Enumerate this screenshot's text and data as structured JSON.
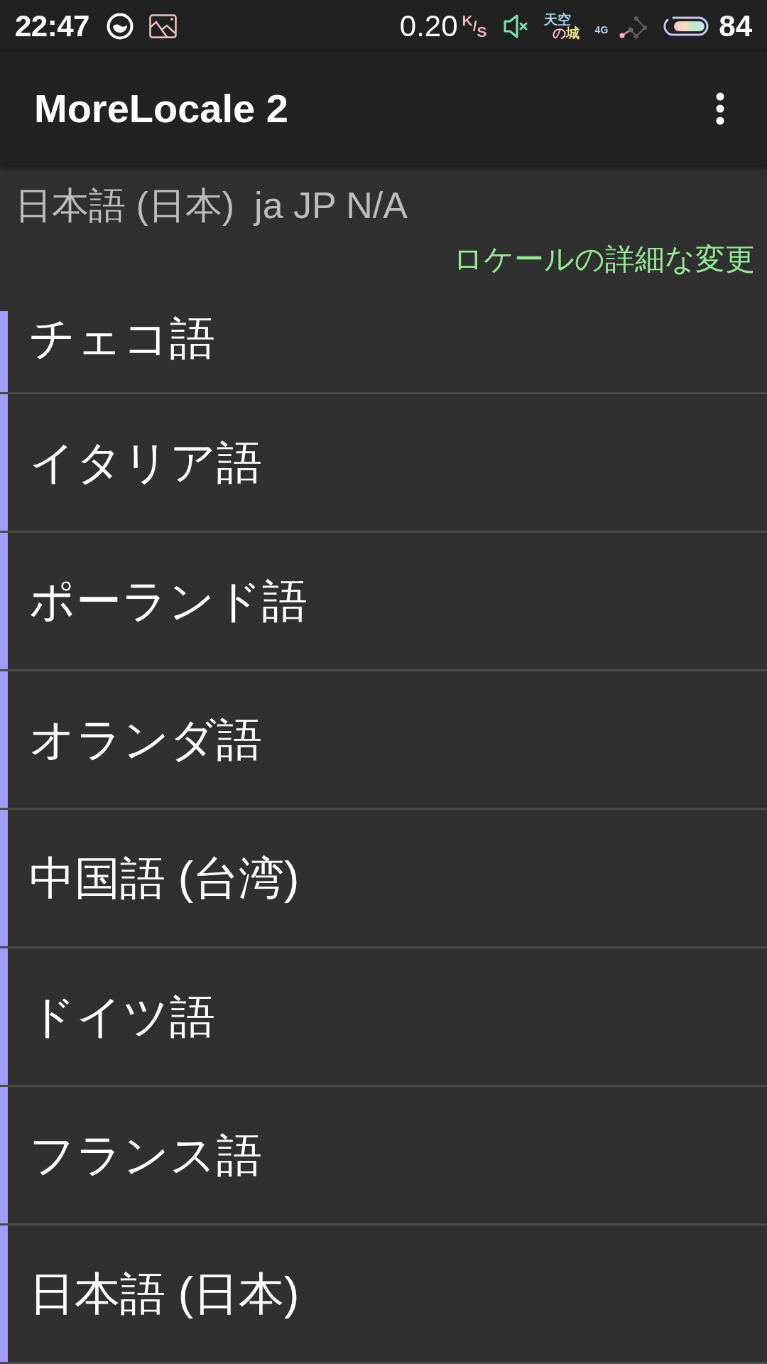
{
  "status_bar": {
    "time": "22:47",
    "net_speed": "0.20",
    "net_speed_unit": "$^{K}$/$_{S}$",
    "carrier": [
      "天空",
      "の城"
    ],
    "network_type": "4G",
    "battery": "84"
  },
  "app_bar": {
    "title": "MoreLocale 2"
  },
  "current_locale": {
    "name": "日本語 (日本)",
    "code": "ja JP N/A"
  },
  "advanced_link": "ロケールの詳細な変更",
  "languages": [
    {
      "label": "チェコ語"
    },
    {
      "label": "イタリア語"
    },
    {
      "label": "ポーランド語"
    },
    {
      "label": "オランダ語"
    },
    {
      "label": "中国語 (台湾)"
    },
    {
      "label": "ドイツ語"
    },
    {
      "label": "フランス語"
    },
    {
      "label": "日本語 (日本)"
    }
  ]
}
